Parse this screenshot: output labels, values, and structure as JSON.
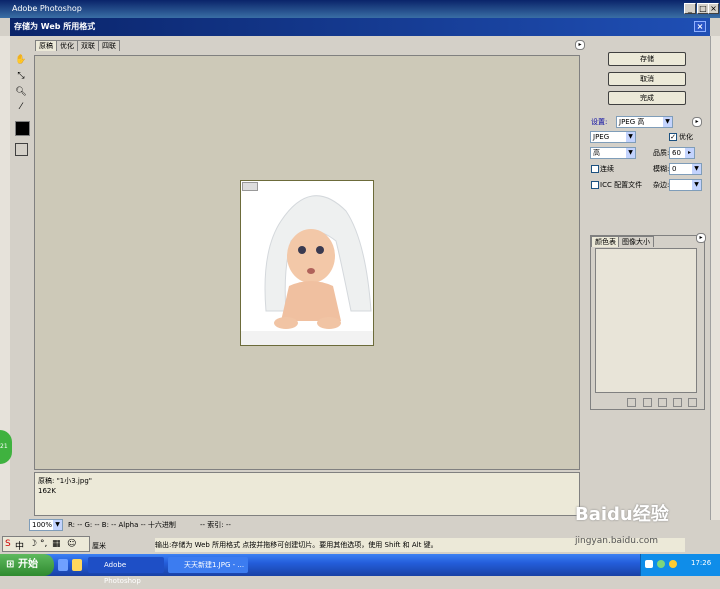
{
  "app_title": "Adobe Photoshop",
  "dialog_title": "存储为 Web 所用格式",
  "tabs": [
    "原稿",
    "优化",
    "双联",
    "四联"
  ],
  "buttons": {
    "save": "存储",
    "cancel": "取消",
    "done": "完成"
  },
  "settings": {
    "label": "设置:",
    "preset": "JPEG 高",
    "format": "JPEG",
    "quality_level": "高",
    "optimized_label": "优化",
    "quality_label": "品质:",
    "quality_value": "60",
    "progressive_label": "连续",
    "blur_label": "模糊:",
    "blur_value": "0",
    "icc_label": "ICC 配置文件",
    "matte_label": "杂边:"
  },
  "panel_tabs": [
    "颜色表",
    "图像大小"
  ],
  "info": {
    "filename": "原稿: \"1小3.jpg\"",
    "size": "162K"
  },
  "status": {
    "zoom": "100%",
    "readout": "R: -- G: -- B: -- Alpha -- 十六进制",
    "index": "-- 索引: --"
  },
  "hint": "输出:存储为 Web 所用格式  点按并拖移可创建切片。要用其他选项，使用 Shift 和 Alt 键。",
  "unit": "厘米",
  "ime": {
    "label": "中"
  },
  "taskbar": {
    "start": "开始",
    "tasks": [
      "Adobe Photoshop",
      "天天新建1.JPG - ..."
    ],
    "clock": "17:26"
  },
  "watermark": {
    "brand": "Baidu经验",
    "url": "jingyan.baidu.com"
  },
  "green_badge": "21",
  "colors": {
    "accent": "#0a246a",
    "canvas": "#cdc9b8",
    "taskbar": "#245edb"
  }
}
